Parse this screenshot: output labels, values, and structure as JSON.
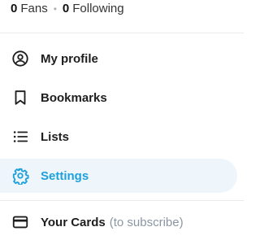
{
  "stats": {
    "fans_count": "0",
    "fans_label": "Fans",
    "separator": "•",
    "following_count": "0",
    "following_label": "Following"
  },
  "menu": {
    "items": [
      {
        "label": "My profile",
        "icon": "user-circle-icon",
        "active": false
      },
      {
        "label": "Bookmarks",
        "icon": "bookmark-icon",
        "active": false
      },
      {
        "label": "Lists",
        "icon": "list-icon",
        "active": false
      },
      {
        "label": "Settings",
        "icon": "gear-icon",
        "active": true
      },
      {
        "label": "Your Cards",
        "suffix": "(to subscribe)",
        "icon": "credit-card-icon",
        "active": false
      }
    ]
  },
  "colors": {
    "accent": "#1fa0dc",
    "active_bg": "#eef6fb",
    "muted": "#8a96a3",
    "divider": "#e9ebed"
  }
}
